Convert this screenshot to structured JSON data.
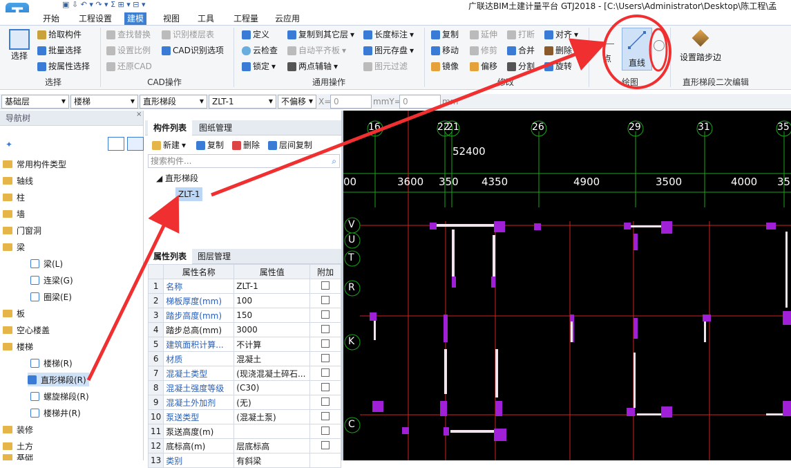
{
  "app": {
    "logo_letter": "T",
    "title": "广联达BIM土建计量平台 GTJ2018 - [C:\\Users\\Administrator\\Desktop\\陈工程\\孟"
  },
  "tabs": [
    "开始",
    "工程设置",
    "建模",
    "视图",
    "工具",
    "工程量",
    "云应用"
  ],
  "ribbon": {
    "select": "选择",
    "pick": "拾取构件",
    "batch": "批量选择",
    "byattr": "按属性选择",
    "find_replace": "查找替换",
    "set_ratio": "设置比例",
    "restore_cad": "还原CAD",
    "identify_floor": "识别楼层表",
    "cad_options": "CAD识别选项",
    "define": "定义",
    "cloud_check": "云检查",
    "lock": "锁定",
    "copy_to_floor": "复制到其它层",
    "auto_flat": "自动平齐板",
    "two_point_axis": "两点辅轴",
    "length_mark": "长度标注",
    "elem_save": "图元存盘",
    "elem_filter": "图元过滤",
    "copy": "复制",
    "move": "移动",
    "mirror": "镜像",
    "extend": "延伸",
    "trim": "修剪",
    "offset": "偏移",
    "break": "打断",
    "merge": "合并",
    "split": "分割",
    "align": "对齐",
    "delete": "删除",
    "rotate": "旋转",
    "point": "点",
    "line": "直线",
    "set_step": "设置踏步边",
    "g_select": "选择",
    "g_cad": "CAD操作",
    "g_general": "通用操作",
    "g_modify": "修改",
    "g_draw": "绘图",
    "g_edit": "直形梯段二次编辑"
  },
  "selbar": {
    "floor": "基础层",
    "type": "楼梯",
    "sub": "直形梯段",
    "name": "ZLT-1",
    "offset": "不偏移",
    "x_label": "X=",
    "x": "0",
    "y_label": "mmY=",
    "y": "0",
    "unit": "mm"
  },
  "nav": {
    "title": "导航树",
    "items": [
      "常用构件类型",
      "轴线",
      "柱",
      "墙",
      "门窗洞",
      "梁",
      "梁(L)",
      "连梁(G)",
      "圈梁(E)",
      "板",
      "空心楼盖",
      "楼梯",
      "楼梯(R)",
      "直形梯段(R)",
      "螺旋梯段(R)",
      "楼梯井(R)",
      "装修",
      "土方",
      "基础"
    ]
  },
  "comp": {
    "tab1": "构件列表",
    "tab2": "图纸管理",
    "new": "新建",
    "copy": "复制",
    "delete": "删除",
    "floor_copy": "层间复制",
    "search": "搜索构件...",
    "parent": "直形梯段",
    "child": "ZLT-1"
  },
  "props": {
    "tab1": "属性列表",
    "tab2": "图层管理",
    "h_name": "属性名称",
    "h_value": "属性值",
    "h_add": "附加",
    "rows": [
      {
        "n": "1",
        "name": "名称",
        "value": "ZLT-1"
      },
      {
        "n": "2",
        "name": "梯板厚度(mm)",
        "value": "100"
      },
      {
        "n": "3",
        "name": "踏步高度(mm)",
        "value": "150"
      },
      {
        "n": "4",
        "name": "踏步总高(mm)",
        "value": "3000"
      },
      {
        "n": "5",
        "name": "建筑面积计算...",
        "value": "不计算"
      },
      {
        "n": "6",
        "name": "材质",
        "value": "混凝土"
      },
      {
        "n": "7",
        "name": "混凝土类型",
        "value": "(现浇混凝土碎石..."
      },
      {
        "n": "8",
        "name": "混凝土强度等级",
        "value": "(C30)"
      },
      {
        "n": "9",
        "name": "混凝土外加剂",
        "value": "(无)"
      },
      {
        "n": "10",
        "name": "泵送类型",
        "value": "(混凝土泵)"
      },
      {
        "n": "11",
        "name": "泵送高度(m)",
        "value": ""
      },
      {
        "n": "12",
        "name": "底标高(m)",
        "value": "层底标高"
      },
      {
        "n": "13",
        "name": "类别",
        "value": "有斜梁"
      }
    ]
  },
  "canvas": {
    "axes_top": [
      "16",
      "22",
      "21",
      "26",
      "29",
      "31",
      "35"
    ],
    "total": "52400",
    "dims": [
      "00",
      "3600",
      "350",
      "4350",
      "4900",
      "3500",
      "4000",
      "35"
    ],
    "axes_left": [
      "V",
      "U",
      "T",
      "R",
      "K",
      "C"
    ]
  }
}
